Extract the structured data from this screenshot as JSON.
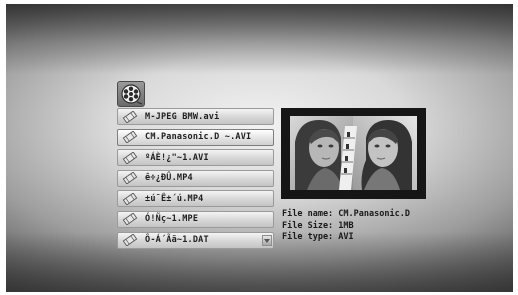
{
  "folder_icon": "film-reel-folder-icon",
  "files": [
    {
      "name": "M-JPEG BMW.avi",
      "icon": "video-file-icon",
      "selected": false
    },
    {
      "name": "CM.Panasonic.D ~.AVI",
      "icon": "video-file-icon",
      "selected": true
    },
    {
      "name": "ºÁÈ!¿\"~1.AVI",
      "icon": "video-file-icon",
      "selected": false
    },
    {
      "name": "ê÷¿ÐÛ.MP4",
      "icon": "video-file-icon",
      "selected": false
    },
    {
      "name": "±ú¯Ê±´ú.MP4",
      "icon": "video-file-icon",
      "selected": false
    },
    {
      "name": "Ó!Ñç~1.MPE",
      "icon": "video-file-icon",
      "selected": false
    },
    {
      "name": "Ô-Á´Ãã~1.DAT",
      "icon": "video-file-icon",
      "selected": false
    }
  ],
  "info": {
    "file_name": "File name: CM.Panasonic.D",
    "file_size": "File Size: 1MB",
    "file_type": "File type: AVI"
  },
  "scroll_icon": "scroll-down-arrow-icon"
}
